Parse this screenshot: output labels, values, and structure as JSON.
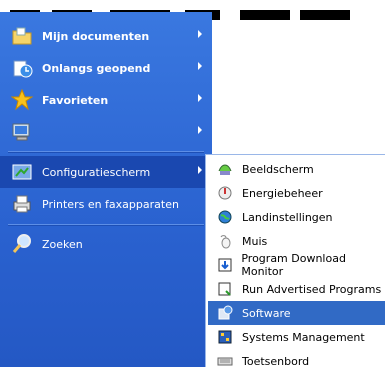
{
  "start_menu": {
    "items": [
      {
        "label": "Mijn documenten",
        "icon": "folder-documents-icon",
        "has_submenu": true,
        "bold": true
      },
      {
        "label": "Onlangs geopend",
        "icon": "recent-documents-icon",
        "has_submenu": true,
        "bold": true
      },
      {
        "label": "Favorieten",
        "icon": "star-favorites-icon",
        "has_submenu": true,
        "bold": true
      },
      {
        "label": "",
        "icon": "computer-icon",
        "has_submenu": true,
        "bold": true
      },
      {
        "label": "Configuratiescherm",
        "icon": "control-panel-icon",
        "has_submenu": true,
        "bold": false,
        "highlighted": true
      },
      {
        "label": "Printers en faxapparaten",
        "icon": "printer-icon",
        "has_submenu": false,
        "bold": false
      },
      {
        "label": "Zoeken",
        "icon": "search-icon",
        "has_submenu": false,
        "bold": false
      }
    ]
  },
  "control_panel_submenu": {
    "items": [
      {
        "label": "Beeldscherm",
        "icon": "display-icon"
      },
      {
        "label": "Energiebeheer",
        "icon": "power-options-icon"
      },
      {
        "label": "Landinstellingen",
        "icon": "globe-icon"
      },
      {
        "label": "Muis",
        "icon": "mouse-icon"
      },
      {
        "label": "Program Download Monitor",
        "icon": "download-monitor-icon"
      },
      {
        "label": "Run Advertised Programs",
        "icon": "run-programs-icon"
      },
      {
        "label": "Software",
        "icon": "software-icon",
        "selected": true
      },
      {
        "label": "Systems Management",
        "icon": "systems-management-icon"
      },
      {
        "label": "Toetsenbord",
        "icon": "keyboard-icon"
      }
    ]
  },
  "colors": {
    "menu_blue": "#2f6ad8",
    "selection_blue": "#316ac5"
  }
}
